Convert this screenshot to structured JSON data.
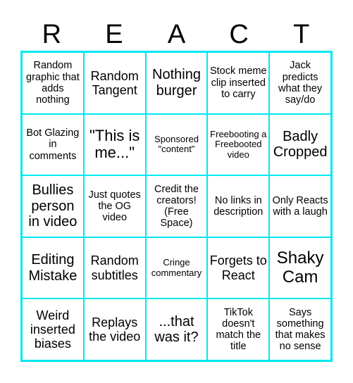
{
  "header": {
    "letters": [
      "R",
      "E",
      "A",
      "C",
      "T"
    ]
  },
  "colors": {
    "grid_border": "#00e8f0",
    "text": "#000000",
    "background": "#ffffff"
  },
  "board": {
    "rows": [
      [
        "Random graphic that adds nothing",
        "Random Tangent",
        "Nothing burger",
        "Stock meme clip inserted to carry",
        "Jack predicts what they say/do"
      ],
      [
        "Bot Glazing in comments",
        "\"This is me...\"",
        "Sponsored \"content\"",
        "Freebooting a Freebooted video",
        "Badly Cropped"
      ],
      [
        "Bullies person in video",
        "Just quotes the OG video",
        "Credit the creators! (Free Space)",
        "No links in description",
        "Only Reacts with a laugh"
      ],
      [
        "Editing Mistake",
        "Random subtitles",
        "Cringe commentary",
        "Forgets to React",
        "Shaky Cam"
      ],
      [
        "Weird inserted biases",
        "Replays the video",
        "...that was it?",
        "TikTok doesn't match the title",
        "Says something that makes no sense"
      ]
    ]
  }
}
